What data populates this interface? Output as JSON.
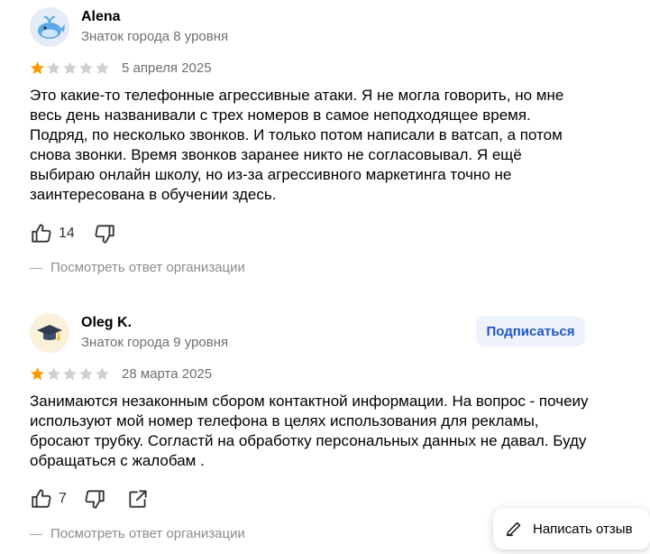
{
  "reviews": [
    {
      "author": "Alena",
      "level": "Знаток города 8 уровня",
      "rating": 1,
      "date": "5 апреля 2025",
      "text": "Это какие-то телефонные агрессивные атаки. Я не могла говорить, но мне весь день названивали с трех номеров в самое неподходящее время. Подряд, по несколько звонков. И только потом написали в ватсап, а потом снова звонки. Время звонков заранее никто не согласовывал. Я ещё выбираю онлайн школу, но из-за агрессивного маркетинга точно не заинтересована в обучении здесь.",
      "likes": "14",
      "reply_link": "Посмотреть ответ организации",
      "avatar_icon": "whale-icon"
    },
    {
      "author": "Oleg K.",
      "level": "Знаток города 9 уровня",
      "rating": 1,
      "date": "28 марта 2025",
      "text": "Занимаются незаконным сбором контактной информации. На вопрос - почеиу используют мой номер телефона в целях использования для рекламы, бросают трубку. Согластй на обработку персональных данных не давал. Буду обращаться с жалобам .",
      "likes": "7",
      "reply_link": "Посмотреть ответ организации",
      "subscribe_label": "Подписаться",
      "avatar_icon": "graduation-cap-icon"
    }
  ],
  "write_review_label": "Написать отзыв",
  "colors": {
    "star_filled": "#fc9b00",
    "star_empty": "#d0d0d0",
    "subscribe_text": "#1f56c6",
    "subscribe_bg": "#eef3fb"
  }
}
